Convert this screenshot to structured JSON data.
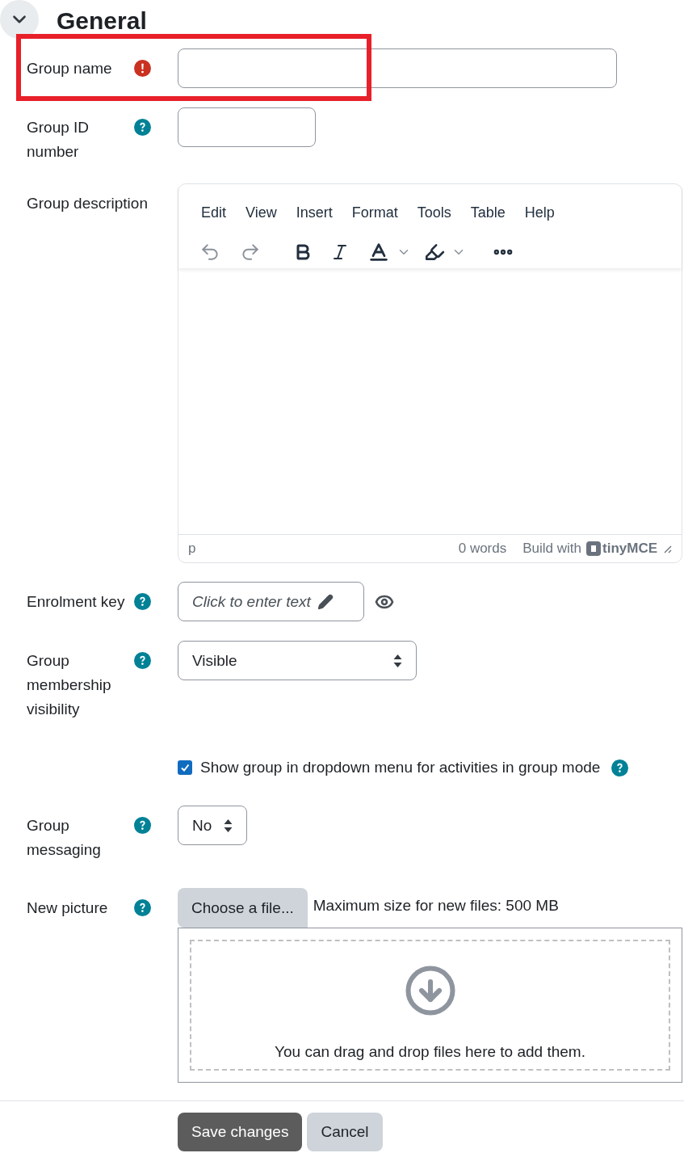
{
  "section": {
    "title": "General",
    "expanded": true
  },
  "fields": [
    {
      "kind": "text",
      "label": "Group name",
      "required": true,
      "help": false,
      "highlighted": true,
      "wide": true
    },
    {
      "kind": "text",
      "label": "Group ID number",
      "required": false,
      "help": true,
      "wide": false
    },
    {
      "kind": "editor",
      "label": "Group description",
      "menu": [
        "Edit",
        "View",
        "Insert",
        "Format",
        "Tools",
        "Table",
        "Help"
      ],
      "path": "p",
      "word_count": "0 words",
      "brand_prefix": "Build with",
      "brand": "tinyMCE"
    },
    {
      "kind": "enrolment",
      "label": "Enrolment key",
      "help": true,
      "placeholder": "Click to enter text"
    },
    {
      "kind": "select",
      "label": "Group membership visibility",
      "help": true,
      "value": "Visible",
      "wide": true
    },
    {
      "kind": "checkbox",
      "label": "Show group in dropdown menu for activities in group mode",
      "help": true,
      "checked": true
    },
    {
      "kind": "select",
      "label": "Group messaging",
      "help": true,
      "value": "No",
      "wide": false
    },
    {
      "kind": "file",
      "label": "New picture",
      "help": true,
      "button": "Choose a file...",
      "note": "Maximum size for new files: 500 MB",
      "drop_text": "You can drag and drop files here to add them."
    }
  ],
  "buttons": [
    {
      "label": "Save changes",
      "kind": "primary"
    },
    {
      "label": "Cancel",
      "kind": "secondary"
    }
  ]
}
